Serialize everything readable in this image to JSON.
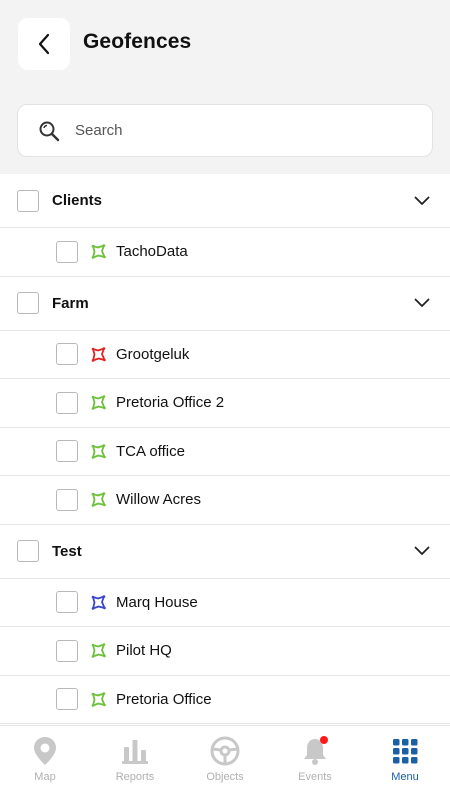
{
  "header": {
    "title": "Geofences"
  },
  "search": {
    "placeholder": "Search"
  },
  "colors": {
    "green": "#6cc03a",
    "red": "#e02424",
    "blue": "#3a45c8",
    "accent": "#1a5fa8",
    "inactive": "#c8c8c8"
  },
  "groups": [
    {
      "label": "Clients",
      "items": [
        {
          "label": "TachoData",
          "icon_color": "green"
        }
      ]
    },
    {
      "label": "Farm",
      "items": [
        {
          "label": "Grootgeluk",
          "icon_color": "red"
        },
        {
          "label": "Pretoria Office 2",
          "icon_color": "green"
        },
        {
          "label": "TCA office",
          "icon_color": "green"
        },
        {
          "label": "Willow Acres",
          "icon_color": "green"
        }
      ]
    },
    {
      "label": "Test",
      "items": [
        {
          "label": "Marq House",
          "icon_color": "blue"
        },
        {
          "label": "Pilot HQ",
          "icon_color": "green"
        },
        {
          "label": "Pretoria Office",
          "icon_color": "green"
        }
      ]
    }
  ],
  "nav": [
    {
      "label": "Map",
      "icon": "map-pin-icon"
    },
    {
      "label": "Reports",
      "icon": "bar-chart-icon"
    },
    {
      "label": "Objects",
      "icon": "steering-wheel-icon"
    },
    {
      "label": "Events",
      "icon": "bell-icon"
    },
    {
      "label": "Menu",
      "icon": "grid-icon"
    }
  ]
}
